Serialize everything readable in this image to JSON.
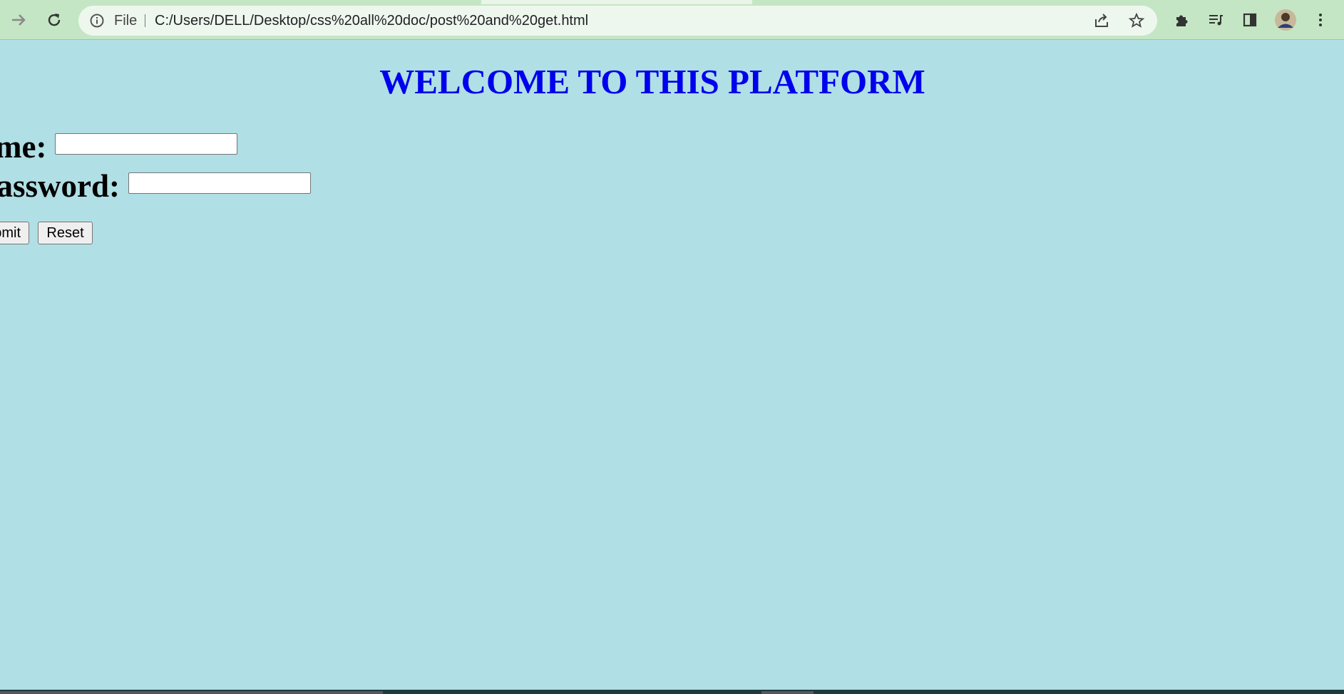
{
  "browser": {
    "site_info_label": "File",
    "url": "C:/Users/DELL/Desktop/css%20all%20doc/post%20and%20get.html",
    "icons": [
      "forward-icon",
      "reload-icon",
      "info-icon",
      "share-icon",
      "star-icon",
      "extensions-icon",
      "media-icon",
      "side-panel-icon",
      "avatar",
      "kebab-menu-icon"
    ]
  },
  "page": {
    "heading": "WELCOME TO THIS PLATFORM",
    "heading_color": "#0000ee",
    "background_color": "#b0dfe5",
    "form": {
      "name_label": "Name:",
      "name_value": "",
      "password_label": "Password:",
      "password_value": "",
      "submit_label": "Submit",
      "reset_label": "Reset"
    }
  }
}
